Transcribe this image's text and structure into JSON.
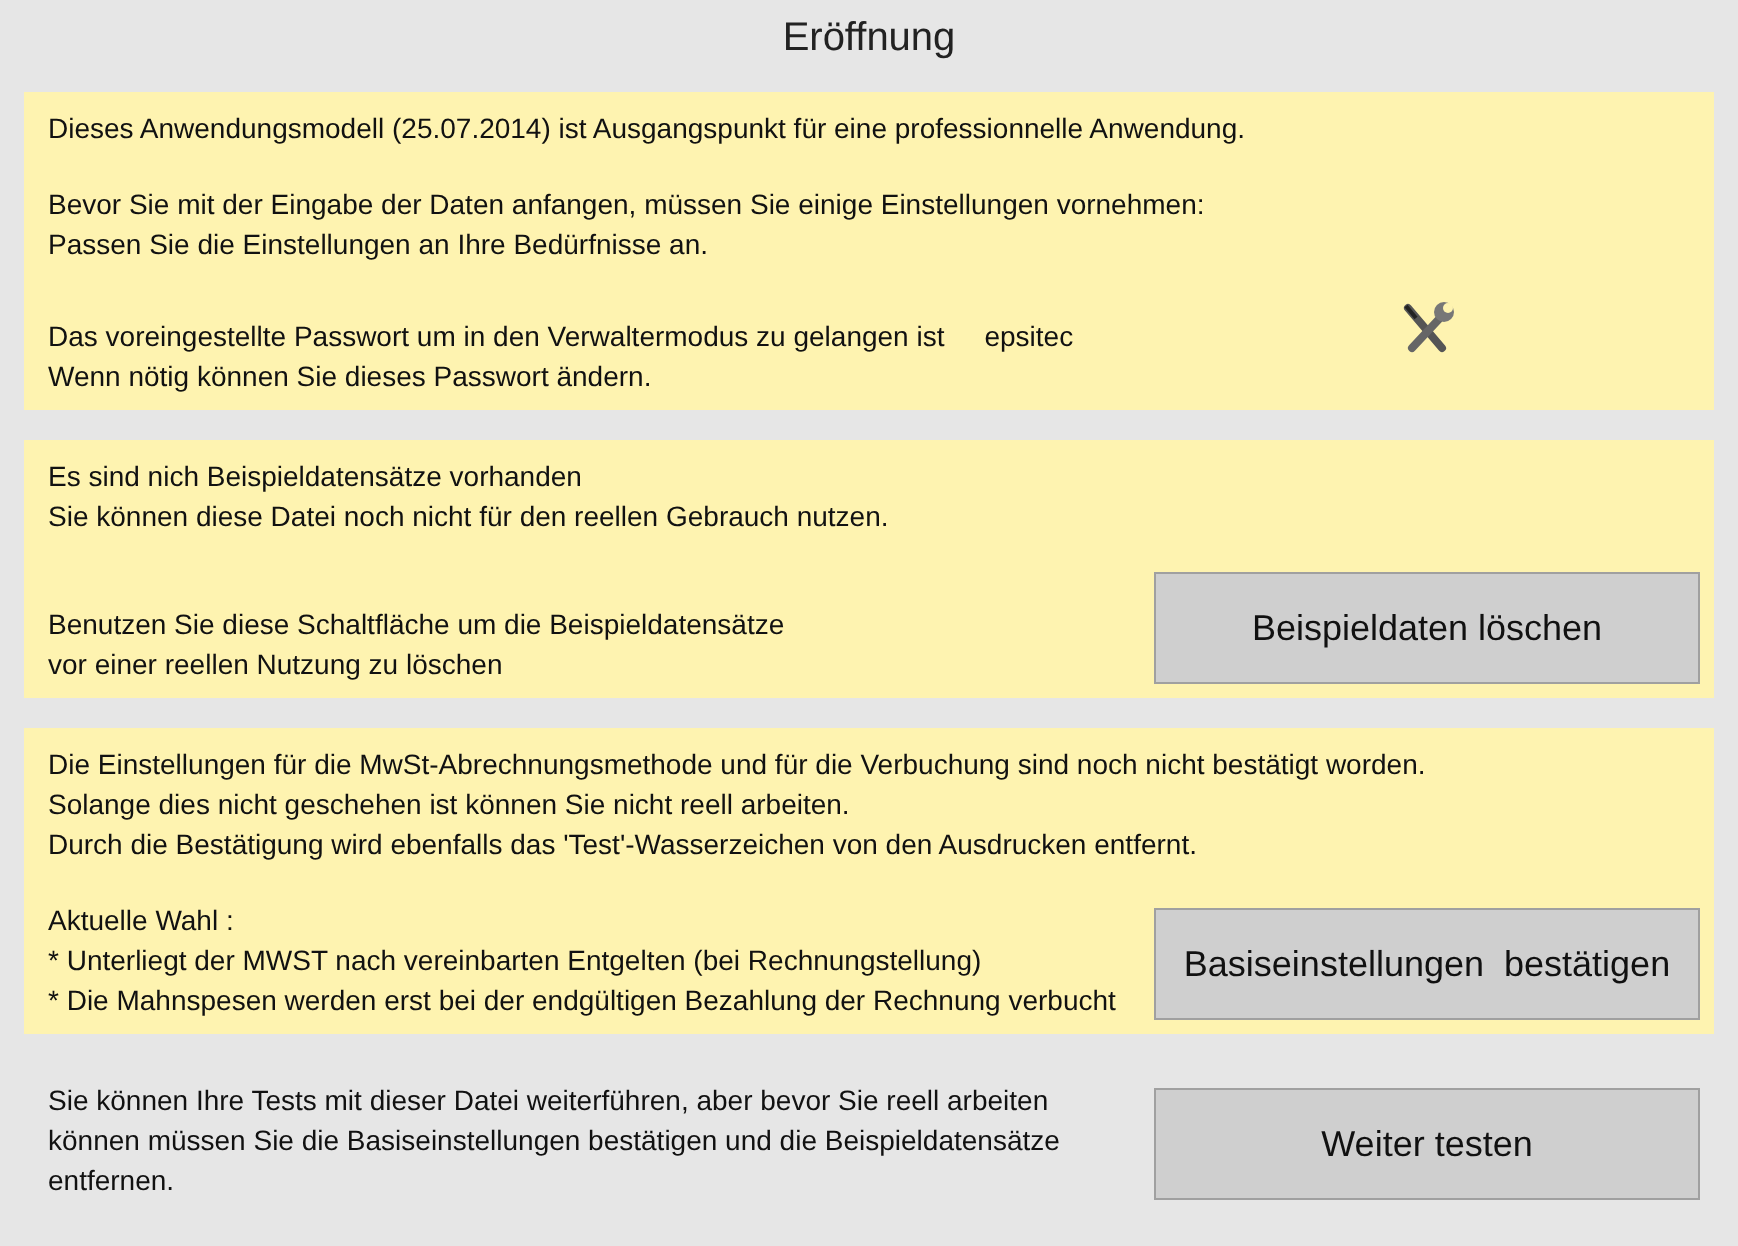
{
  "title": "Eröffnung",
  "sections": [
    {
      "highlighted": true,
      "groups": [
        [
          {
            "kind": "text",
            "text": "Dieses Anwendungsmodell (25.07.2014) ist Ausgangspunkt für eine professionnelle Anwendung."
          }
        ],
        [
          {
            "kind": "text",
            "text": "Bevor Sie mit der Eingabe der Daten anfangen, müssen Sie einige Einstellungen vornehmen:"
          },
          {
            "kind": "text",
            "text": "Passen Sie die Einstellungen an Ihre Bedürfnisse an."
          }
        ],
        [
          {
            "kind": "pair",
            "label": "Das voreingestellte Passwort um in den Verwaltermodus zu gelangen ist",
            "value": "epsitec"
          },
          {
            "kind": "text",
            "text": "Wenn nötig können Sie dieses Passwort ändern."
          }
        ]
      ],
      "action": {
        "kind": "tools"
      }
    },
    {
      "highlighted": true,
      "groups": [
        [
          {
            "kind": "text",
            "text": "Es sind nich Beispieldatensätze vorhanden"
          },
          {
            "kind": "text",
            "text": "Sie können diese Datei noch nicht für den reellen Gebrauch nutzen."
          }
        ],
        [
          {
            "kind": "text",
            "text": "Benutzen Sie diese Schaltfläche um die Beispieldatensätze"
          },
          {
            "kind": "text",
            "text": "vor einer reellen Nutzung zu löschen"
          }
        ]
      ],
      "action": {
        "kind": "button",
        "label": "Beispieldaten löschen"
      }
    },
    {
      "highlighted": true,
      "groups": [
        [
          {
            "kind": "text",
            "text": "Die Einstellungen für die MwSt-Abrechnungsmethode und für die Verbuchung sind noch nicht bestätigt worden."
          },
          {
            "kind": "text",
            "text": "Solange dies nicht geschehen ist können Sie nicht reell arbeiten."
          },
          {
            "kind": "text",
            "text": "Durch die Bestätigung wird ebenfalls das 'Test'-Wasserzeichen von den Ausdrucken entfernt."
          }
        ],
        [
          {
            "kind": "text",
            "text": "Aktuelle Wahl :"
          },
          {
            "kind": "text",
            "text": "* Unterliegt der MWST nach vereinbarten Entgelten (bei Rechnungstellung)"
          },
          {
            "kind": "text",
            "text": "* Die Mahnspesen werden erst bei der endgültigen Bezahlung der Rechnung verbucht"
          }
        ]
      ],
      "action": {
        "kind": "button",
        "label": "Basiseinstellungen  bestätigen"
      }
    },
    {
      "highlighted": false,
      "groups": [
        [
          {
            "kind": "text",
            "text": "Sie können Ihre Tests mit dieser Datei weiterführen, aber bevor Sie reell arbeiten"
          },
          {
            "kind": "text",
            "text": "können müssen Sie die Basiseinstellungen bestätigen und die Beispieldatensätze"
          },
          {
            "kind": "text",
            "text": "entfernen."
          }
        ]
      ],
      "action": {
        "kind": "button",
        "label": "Weiter testen"
      }
    }
  ]
}
